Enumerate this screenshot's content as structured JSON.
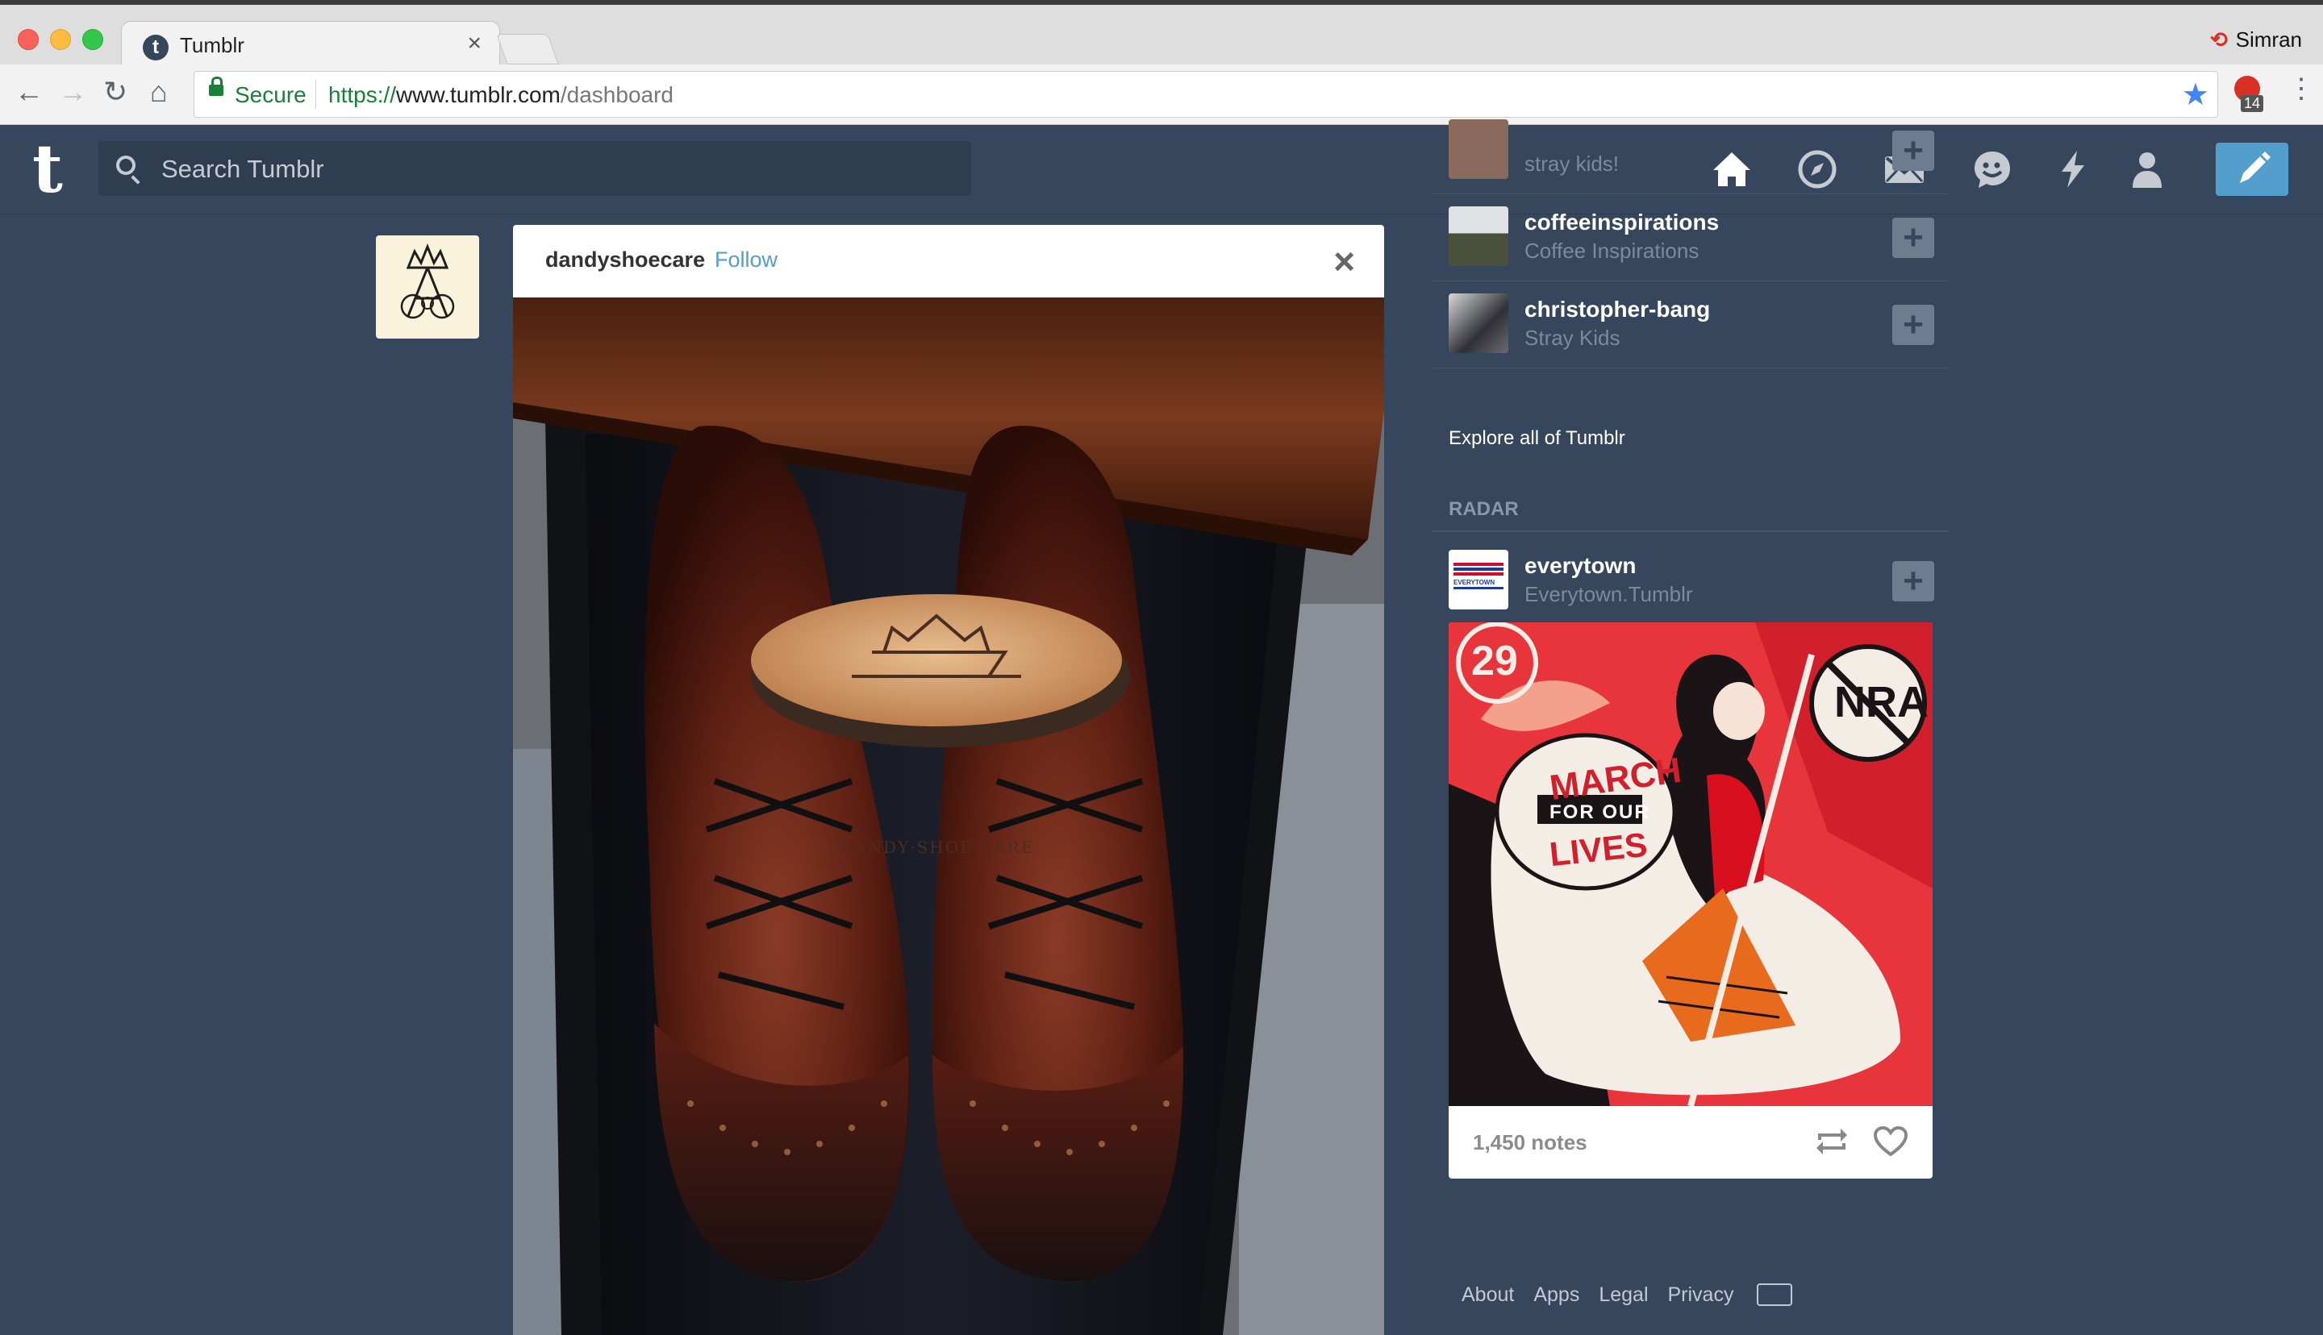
{
  "browser": {
    "tab_title": "Tumblr",
    "tab_close": "×",
    "profile_name": "Simran",
    "secure_label": "Secure",
    "url_scheme": "https://",
    "url_host": "www.tumblr.com",
    "url_path": "/dashboard",
    "extension_badge": "14"
  },
  "header": {
    "logo": "t",
    "search_placeholder": "Search Tumblr",
    "nav_icons": [
      "home-icon",
      "explore-compass-icon",
      "inbox-mail-icon",
      "messaging-chat-icon",
      "activity-lightning-icon",
      "account-person-icon"
    ],
    "compose_icon": "pencil-icon",
    "accent_color": "#529ecc",
    "background_color": "#36465d"
  },
  "post": {
    "blog_name": "dandyshoecare",
    "follow_label": "Follow",
    "close_icon": "×",
    "photo_brand_text": "DANDY·SHOE CARE"
  },
  "sidebar": {
    "partial_top_text": "stray kids!",
    "recommended": [
      {
        "name": "coffeeinspirations",
        "title": "Coffee Inspirations"
      },
      {
        "name": "christopher-bang",
        "title": "Stray Kids"
      }
    ],
    "explore_label": "Explore all of Tumblr",
    "radar_heading": "RADAR",
    "radar": {
      "name": "everytown",
      "title": "Everytown.Tumblr",
      "avatar_text": "EVERYTOWN",
      "image_text": {
        "march": "MARCH",
        "for_our": "FOR OUR",
        "lives": "LIVES",
        "nra": "NRA",
        "number": "29"
      },
      "notes": "1,450 notes"
    }
  },
  "footer": {
    "links": [
      "About",
      "Apps",
      "Legal",
      "Privacy"
    ]
  }
}
